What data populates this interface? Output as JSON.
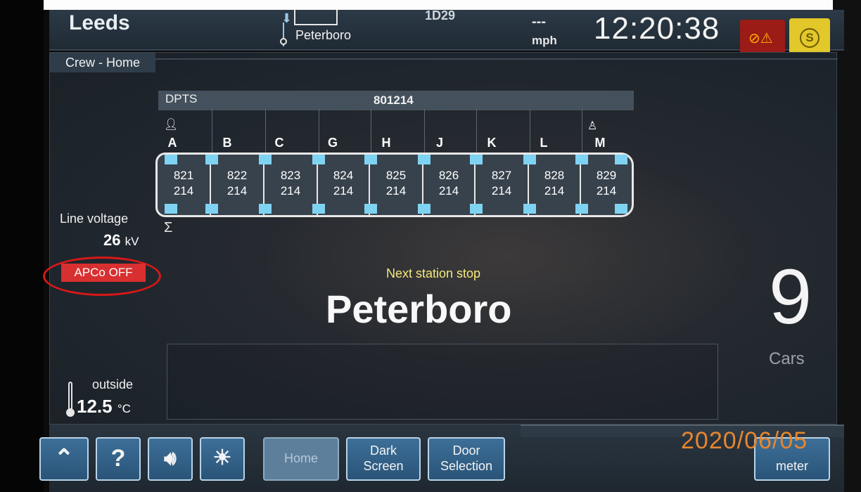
{
  "topbar": {
    "origin": "Leeds",
    "destination": "Peterboro",
    "headcode": "1D29",
    "speed": "---",
    "speed_unit": "mph",
    "clock": "12:20:38"
  },
  "screen": {
    "title": "Crew - Home"
  },
  "train": {
    "type": "DPTS",
    "unit_number": "801214",
    "cars": [
      {
        "letter": "A",
        "top": "821",
        "bottom": "214"
      },
      {
        "letter": "B",
        "top": "822",
        "bottom": "214"
      },
      {
        "letter": "C",
        "top": "823",
        "bottom": "214"
      },
      {
        "letter": "G",
        "top": "824",
        "bottom": "214"
      },
      {
        "letter": "H",
        "top": "825",
        "bottom": "214"
      },
      {
        "letter": "J",
        "top": "826",
        "bottom": "214"
      },
      {
        "letter": "K",
        "top": "827",
        "bottom": "214"
      },
      {
        "letter": "L",
        "top": "828",
        "bottom": "214"
      },
      {
        "letter": "M",
        "top": "829",
        "bottom": "214"
      }
    ]
  },
  "info": {
    "line_voltage_label": "Line voltage",
    "line_voltage_value": "26",
    "line_voltage_unit": "kV",
    "apco_status": "APCo OFF",
    "outside_label": "outside",
    "outside_value": "12.5",
    "outside_unit": "°C"
  },
  "next_stop": {
    "label": "Next station stop",
    "station": "Peterboro"
  },
  "cars_count": {
    "value": "9",
    "label": "Cars"
  },
  "buttons": {
    "home": "Home",
    "dark_screen_1": "Dark",
    "dark_screen_2": "Screen",
    "door_1": "Door",
    "door_2": "Selection",
    "meter": "meter"
  },
  "date_stamp": "2020/06/05",
  "colors": {
    "apco_red": "#d83030",
    "next_label_yellow": "#f5e97a",
    "door_cyan": "#7fd3f2",
    "button_blue": "#2a5478",
    "date_orange": "#e7862e"
  },
  "icons": [
    "up-arrow-icon",
    "help-icon",
    "speaker-icon",
    "brightness-icon",
    "alarm-icon",
    "s-mode-icon",
    "thermometer-icon",
    "cab-occupied-icon",
    "cab-empty-icon",
    "sigma-icon"
  ]
}
